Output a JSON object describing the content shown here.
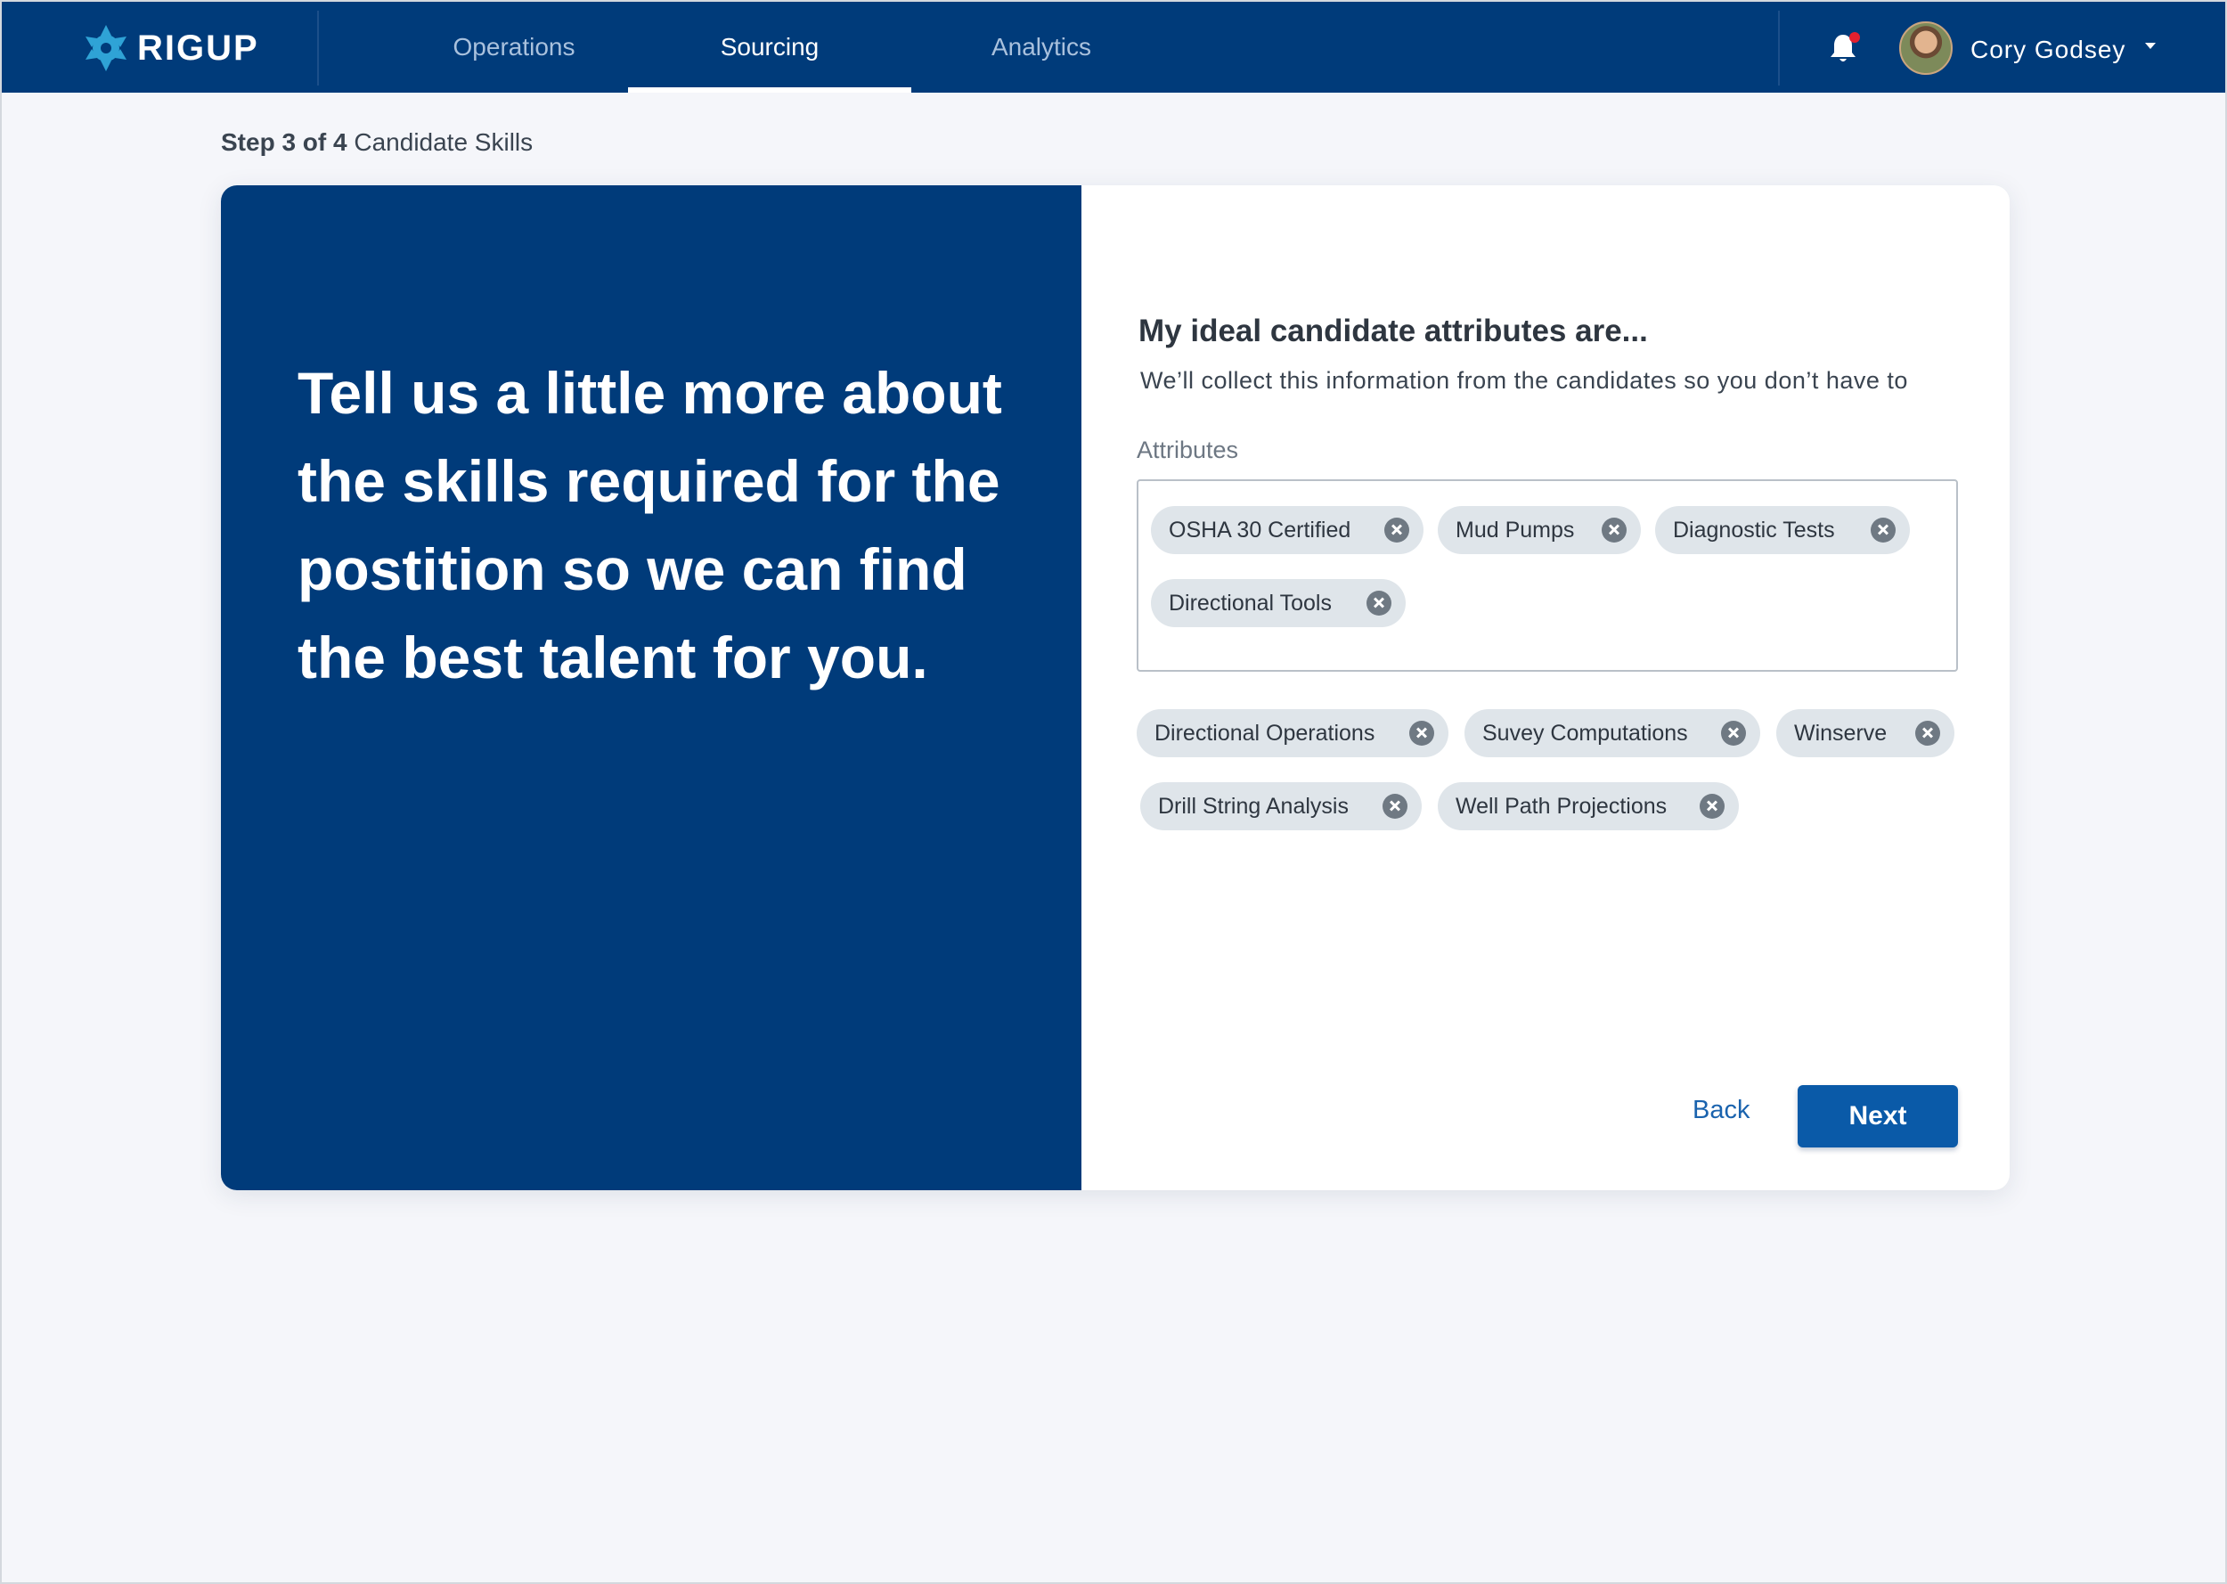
{
  "brand": {
    "name": "RIGUP",
    "logo_icon": "rigup-gear-icon",
    "color": "#003b7a"
  },
  "nav": {
    "tabs": [
      {
        "label": "Operations",
        "active": false
      },
      {
        "label": "Sourcing",
        "active": true
      },
      {
        "label": "Analytics",
        "active": false
      }
    ],
    "notifications_icon": "bell-icon",
    "notification_dot_color": "#e5202e",
    "user": {
      "name": "Cory Godsey",
      "menu_icon": "caret-down-icon"
    }
  },
  "step": {
    "prefix": "Step 3 of 4",
    "title": "Candidate Skills"
  },
  "left_panel": {
    "headline": "Tell us a little more about the skills required for the postition so we can find the best talent for you."
  },
  "form": {
    "title": "My ideal candidate attributes are...",
    "subtitle": "We’ll collect this information from the candidates so you don’t have to",
    "field_label": "Attributes",
    "selected_attributes": [
      "OSHA 30 Certified",
      "Mud Pumps",
      "Diagnostic Tests",
      "Directional Tools"
    ],
    "suggested_attributes": [
      "Directional Operations",
      "Suvey Computations",
      "Winserve",
      "Drill String Analysis",
      "Well Path Projections"
    ],
    "remove_icon": "close-circle-icon"
  },
  "actions": {
    "back_label": "Back",
    "next_label": "Next"
  }
}
